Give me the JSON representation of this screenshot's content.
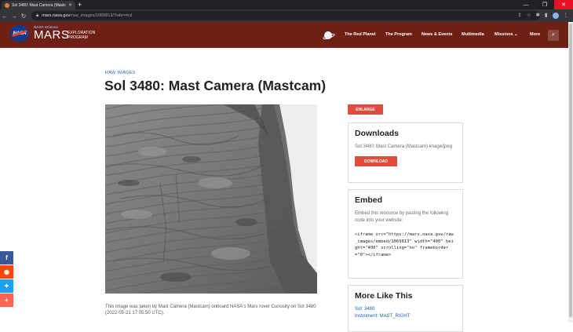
{
  "browser": {
    "tab_title": "Sol 3480: Mast Camera (Mastcam)",
    "tab_close": "✕",
    "new_tab": "+",
    "back": "←",
    "forward": "→",
    "reload": "↻",
    "url_host": "mars.nasa.gov",
    "url_path": "/raw_images/1069813/?site=msl",
    "minimize": "—",
    "maximize": "❐",
    "close": "✕"
  },
  "header": {
    "logo_text": "NASA",
    "brand_small": "NASA Science",
    "brand_main": "MARS",
    "brand_sub": "EXPLORATION PROGRAM",
    "nav": [
      "The Red Planet",
      "The Program",
      "News & Events",
      "Multimedia",
      "Missions ⌄",
      "More"
    ],
    "search_icon": "⌕",
    "colors": {
      "header_bg": "#6e1f16",
      "accent": "#e04d3e",
      "link": "#1a64b4"
    }
  },
  "page": {
    "eyebrow": "RAW IMAGES",
    "title": "Sol 3480: Mast Camera (Mastcam)",
    "caption": "This image was taken by Mast Camera (Mastcam) onboard NASA's Mars rover Curiosity on Sol 3480 (2022-05-21 17:05:50 UTC)."
  },
  "sidebar": {
    "enlarge_label": "ENLARGE",
    "downloads": {
      "heading": "Downloads",
      "description": "Sol 3480: Mast Camera (Mastcam) image/jpeg",
      "button": "DOWNLOAD"
    },
    "embed": {
      "heading": "Embed",
      "description": "Embed this resource by pasting the following code into your website:",
      "code": "<iframe src=\"https://mars.nasa.gov/raw_images/embed/1069813\" width=\"400\" height=\"400\" scrolling=\"no\" frameborder=\"0\"></iframe>"
    },
    "more": {
      "heading": "More Like This",
      "links": [
        "Sol: 3480",
        "Instrument: MAST_RIGHT"
      ]
    }
  },
  "social": [
    {
      "icon": "facebook-icon",
      "glyph": "f",
      "color": "#3b5998"
    },
    {
      "icon": "reddit-icon",
      "glyph": "◉",
      "color": "#ff4500"
    },
    {
      "icon": "twitter-icon",
      "glyph": "✦",
      "color": "#1da1f2"
    },
    {
      "icon": "share-icon",
      "glyph": "+",
      "color": "#ff6550"
    }
  ]
}
